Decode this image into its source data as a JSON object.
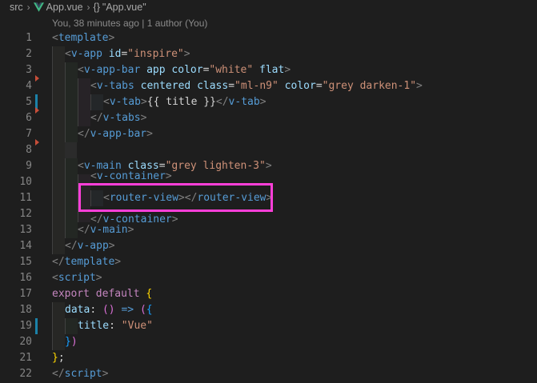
{
  "breadcrumb": {
    "folder": "src",
    "file": "App.vue",
    "symbol_icon": "{}",
    "symbol": "\"App.vue\""
  },
  "blame": "You, 38 minutes ago | 1 author (You)",
  "colors": {
    "background": "#1e1e1e",
    "tag": "#569cd6",
    "attribute": "#9cdcfe",
    "string": "#ce9178",
    "keyword": "#c586c0",
    "highlight": "#ff3fd9",
    "git_modified": "#1b81a8",
    "git_deleted": "#c74e39"
  },
  "lines": [
    {
      "n": "1"
    },
    {
      "n": "2"
    },
    {
      "n": "3"
    },
    {
      "n": "4"
    },
    {
      "n": "5"
    },
    {
      "n": "6"
    },
    {
      "n": "7"
    },
    {
      "n": "8"
    },
    {
      "n": "9"
    },
    {
      "n": "10"
    },
    {
      "n": "11"
    },
    {
      "n": "12"
    },
    {
      "n": "13"
    },
    {
      "n": "14"
    },
    {
      "n": "15"
    },
    {
      "n": "16"
    },
    {
      "n": "17"
    },
    {
      "n": "18"
    },
    {
      "n": "19"
    },
    {
      "n": "20"
    },
    {
      "n": "21"
    },
    {
      "n": "22"
    }
  ],
  "code": {
    "template": "template",
    "v_app": "v-app",
    "id_attr": "id",
    "id_val": "\"inspire\"",
    "v_app_bar": "v-app-bar",
    "app_attr": "app",
    "color_attr": "color",
    "white_val": "\"white\"",
    "flat_attr": "flat",
    "v_tabs": "v-tabs",
    "centered_attr": "centered",
    "class_attr": "class",
    "ml_val": "\"ml-n9\"",
    "grey_val": "\"grey darken-1\"",
    "v_tab": "v-tab",
    "title_interp": "{{ title }}",
    "v_main": "v-main",
    "grey_lighten_val": "\"grey lighten-3\"",
    "v_container": "v-container",
    "router_view": "router-view",
    "script": "script",
    "export_kw": "export",
    "default_kw": "default",
    "data_prop": "data",
    "arrow": "=>",
    "title_prop": "title",
    "vue_val": "\"Vue\""
  }
}
